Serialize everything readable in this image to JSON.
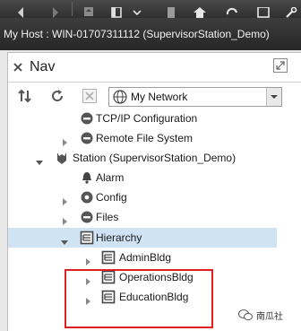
{
  "host_bar": {
    "label": "My Host : WIN-01707311112 (SupervisorStation_Demo)"
  },
  "nav": {
    "title": "Nav",
    "network_select": {
      "selected": "My Network"
    }
  },
  "tree": {
    "items": [
      {
        "label": "TCP/IP Configuration",
        "icon": "tcpip-icon",
        "expandable": false,
        "expanded": false
      },
      {
        "label": "Remote File System",
        "icon": "remote-file-system-icon",
        "expandable": true,
        "expanded": false
      },
      {
        "label": "Station (SupervisorStation_Demo)",
        "icon": "station-icon",
        "expandable": true,
        "expanded": true
      },
      {
        "label": "Alarm",
        "icon": "bell-icon",
        "expandable": false,
        "expanded": false
      },
      {
        "label": "Config",
        "icon": "gear-icon",
        "expandable": true,
        "expanded": false
      },
      {
        "label": "Files",
        "icon": "drive-icon",
        "expandable": true,
        "expanded": false
      },
      {
        "label": "Hierarchy",
        "icon": "hierarchy-icon",
        "expandable": true,
        "expanded": true,
        "selected": true
      },
      {
        "label": "AdminBldg",
        "icon": "hierarchy-icon",
        "expandable": true,
        "expanded": false
      },
      {
        "label": "OperationsBldg",
        "icon": "hierarchy-icon",
        "expandable": true,
        "expanded": false
      },
      {
        "label": "EducationBldg",
        "icon": "hierarchy-icon",
        "expandable": true,
        "expanded": false
      }
    ]
  },
  "watermark": {
    "text": "南瓜社"
  },
  "colors": {
    "selection": "#cfe3f5",
    "highlight_box": "#e02020",
    "toolbar": "#3a3a3a"
  }
}
